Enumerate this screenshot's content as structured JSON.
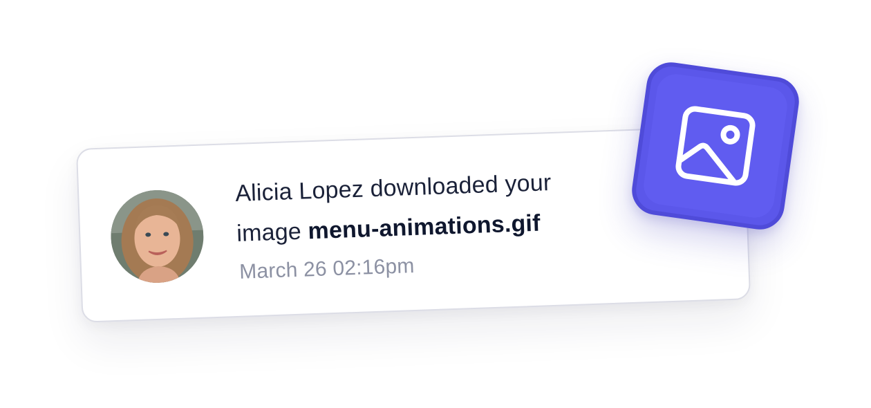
{
  "notification": {
    "message_prefix": "Alicia Lopez downloaded your image ",
    "file_name": "menu-animations.gif",
    "timestamp": "March 26 02:16pm",
    "avatar": "user-photo-avatar",
    "badge_icon": "image-icon"
  },
  "colors": {
    "accent": "#5b57ea",
    "text_primary": "#1a2138",
    "text_muted": "#8c91a3",
    "card_border": "#dcdde6"
  }
}
